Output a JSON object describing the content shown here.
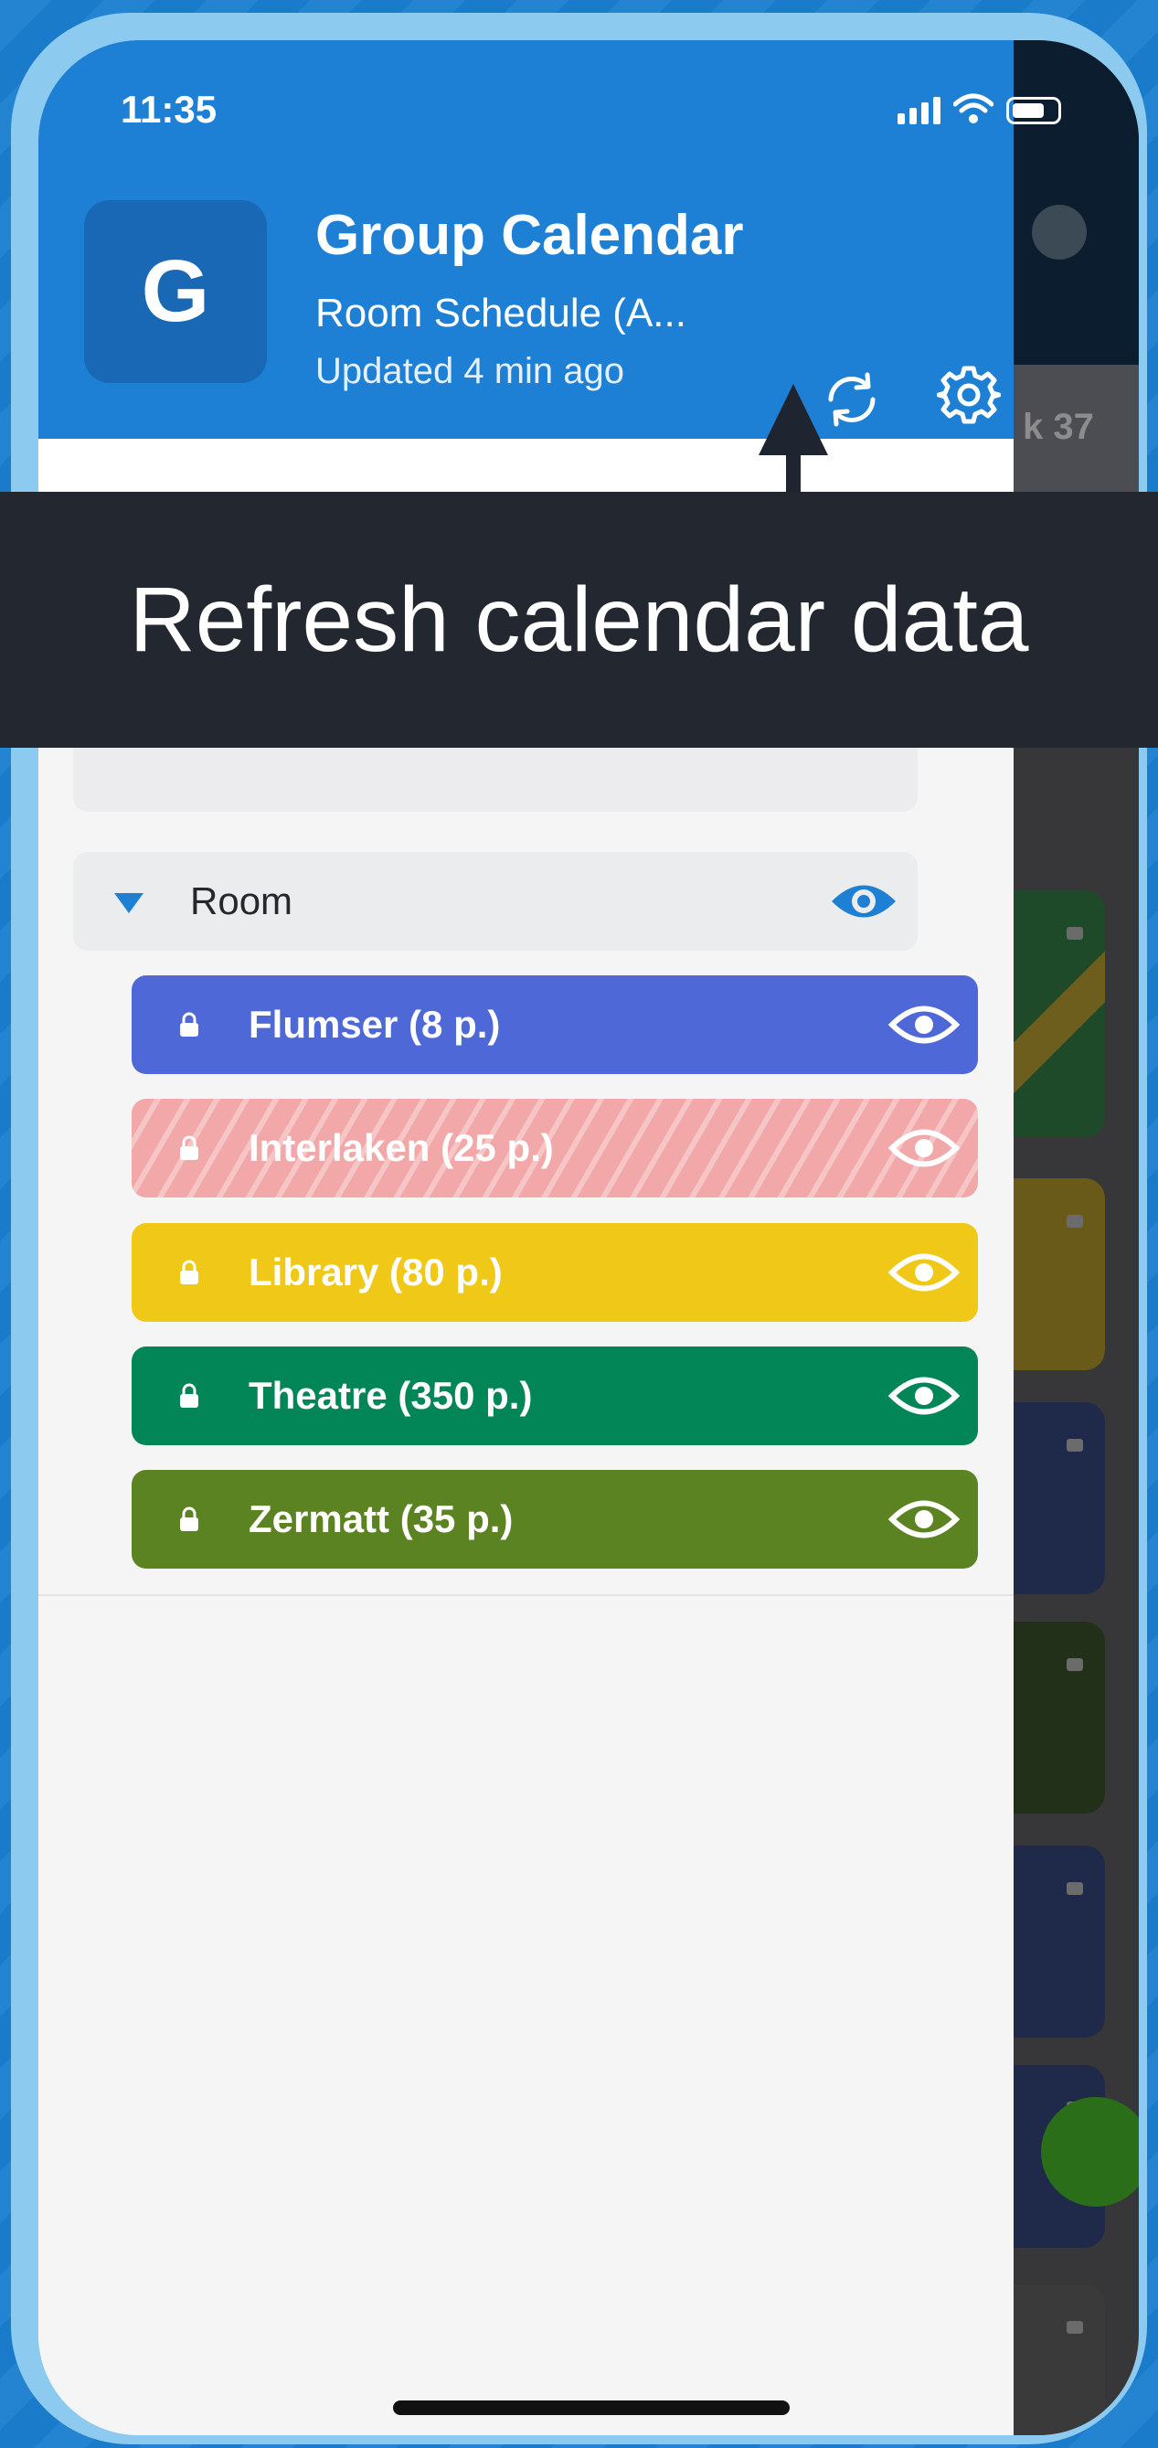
{
  "status_bar": {
    "time": "11:35"
  },
  "header": {
    "avatar_letter": "G",
    "title": "Group Calendar",
    "subtitle": "Room Schedule (A...",
    "updated": "Updated 4 min ago",
    "refresh_icon": "refresh-icon",
    "settings_icon": "gear-icon"
  },
  "underlay": {
    "week_label": "k 37"
  },
  "tooltip": {
    "text": "Refresh calendar data"
  },
  "group": {
    "label": "Room"
  },
  "rooms": [
    {
      "label": "Flumser (8 p.)",
      "color": "#4e68d8",
      "hidden": false
    },
    {
      "label": "Interlaken (25 p.)",
      "color": "#f2a8a8",
      "hidden": true
    },
    {
      "label": "Library (80 p.)",
      "color": "#f0c817",
      "hidden": false
    },
    {
      "label": "Theatre (350 p.)",
      "color": "#028658",
      "hidden": false
    },
    {
      "label": "Zermatt (35 p.)",
      "color": "#5c8322",
      "hidden": false
    }
  ],
  "colors": {
    "accent": "#1d80d4",
    "tooltip_bg": "#222730"
  }
}
